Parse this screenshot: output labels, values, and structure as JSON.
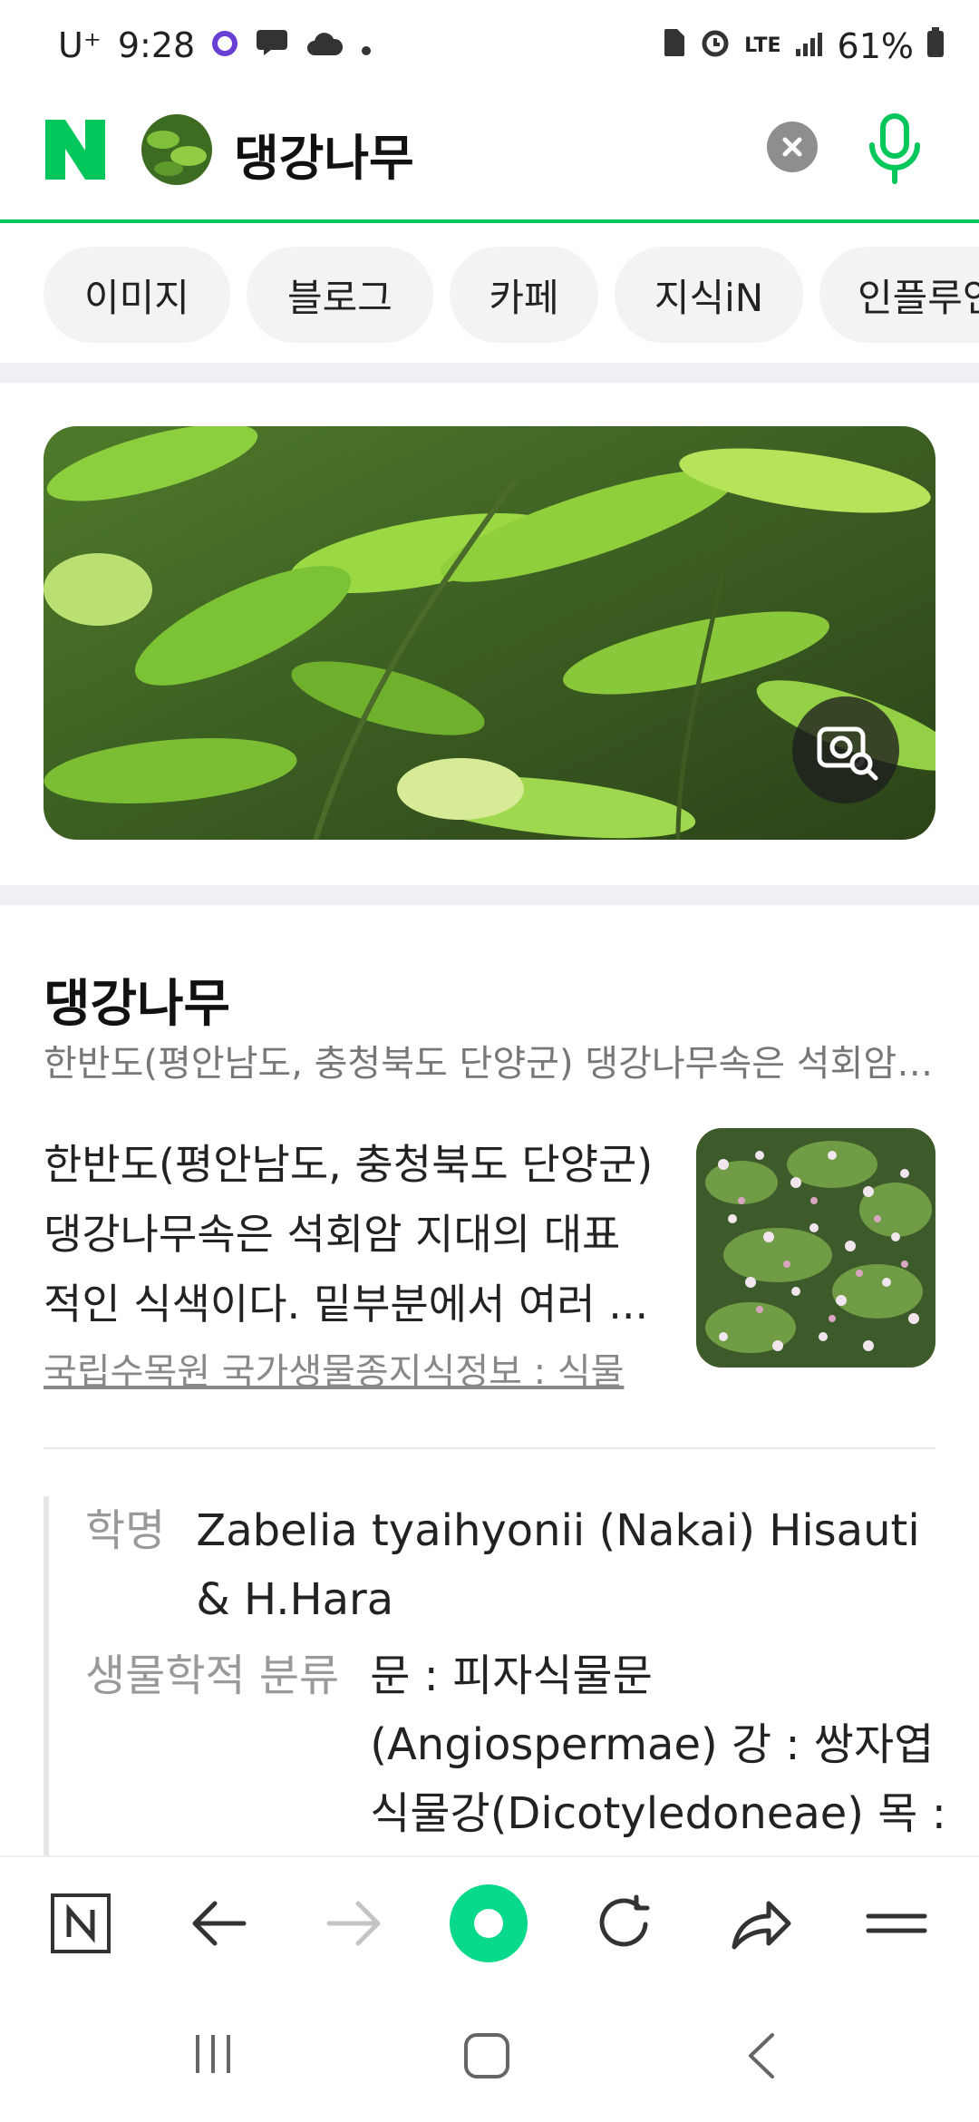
{
  "status": {
    "carrier": "U⁺",
    "time": "9:28",
    "network": "LTE",
    "battery": "61%"
  },
  "search": {
    "query": "댕강나무"
  },
  "chips": [
    "이미지",
    "블로그",
    "카페",
    "지식iN",
    "인플루언"
  ],
  "entry": {
    "title": "댕강나무",
    "summary": "한반도(평안남도, 충청북도 단양군) 댕강나무속은 석회암 ...",
    "description_lines": [
      "한반도(평안남도, 충청북도 단양군)",
      "댕강나무속은 석회암 지대의 대표",
      "적인 식색이다. 밑부분에서 여러 ..."
    ],
    "source": "국립수목원 국가생물종지식정보 : 식물"
  },
  "info": {
    "sci_label": "학명",
    "sci_value": "Zabelia tyaihyonii (Nakai) Hisauti & H.Hara",
    "tax_label": "생물학적 분류",
    "tax_value": "문 : 피자식물문 (Angiospermae) 강 : 쌍자엽식물강(Dicotyledoneae) 목 : 산토"
  },
  "colors": {
    "brand": "#03c75a",
    "chip_bg": "#f2f3f5"
  },
  "icons": [
    "naver-n-icon",
    "clear-icon",
    "mic-icon",
    "lens-search-icon",
    "home-n-icon",
    "back-icon",
    "forward-icon",
    "green-dot-icon",
    "reload-icon",
    "share-icon",
    "menu-icon",
    "recents-icon",
    "home-icon",
    "nav-back-icon"
  ]
}
